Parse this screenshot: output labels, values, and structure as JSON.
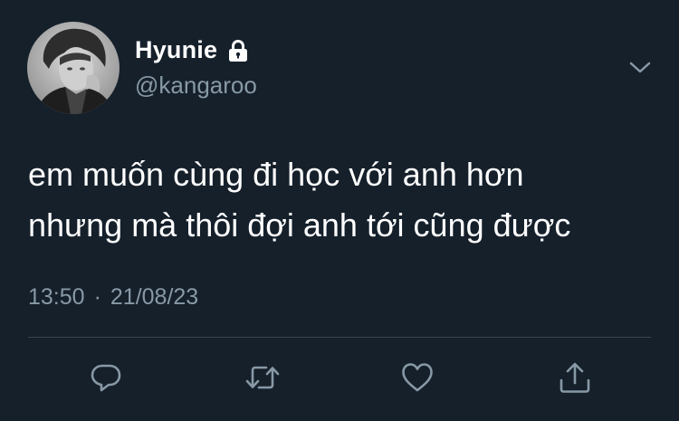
{
  "tweet": {
    "display_name": "Hyunie",
    "handle": "@kangaroo",
    "protected_icon": "lock-icon",
    "text_lines": [
      "em muốn cùng đi học với anh hơn",
      "nhưng mà thôi đợi anh tới cũng được"
    ],
    "time": "13:50",
    "separator": "·",
    "date": "21/08/23"
  },
  "actions": [
    {
      "name": "reply",
      "icon": "reply-icon"
    },
    {
      "name": "retweet",
      "icon": "retweet-icon"
    },
    {
      "name": "like",
      "icon": "heart-icon"
    },
    {
      "name": "share",
      "icon": "share-icon"
    }
  ],
  "colors": {
    "background": "#15202b",
    "primary_text": "#ffffff",
    "secondary_text": "#8899a6",
    "divider": "#38444d"
  }
}
